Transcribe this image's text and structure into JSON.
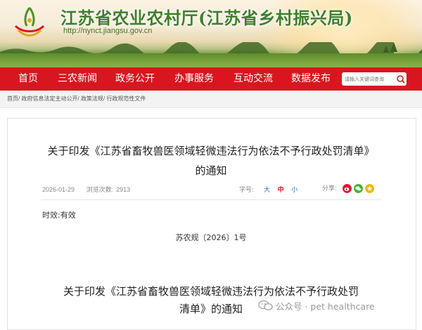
{
  "header": {
    "site_title": "江苏省农业农村厅(江苏省乡村振兴局)",
    "site_url": "http://nynct.jiangsu.gov.cn"
  },
  "nav": {
    "items": [
      "首页",
      "三农新闻",
      "政务公开",
      "办事服务",
      "互动交流",
      "数据发布"
    ],
    "search_placeholder": "请输入关键词查询"
  },
  "breadcrumb": {
    "items": [
      "首页",
      "政府信息法定主动公开",
      "政策法规",
      "行政规范性文件"
    ],
    "separator": "/"
  },
  "article": {
    "title_line1": "关于印发《江苏省畜牧兽医领域轻微违法行为依法不予行政处罚清单》",
    "title_line2": "的通知",
    "date": "2026-01-29",
    "views_label": "浏览次数:",
    "views": "2913",
    "font_size_label": "字号:",
    "font_sizes": [
      "大",
      "中",
      "小"
    ],
    "share_label": "分享:",
    "share_icons": [
      "weibo-icon",
      "wechat-icon",
      "qzone-icon"
    ],
    "validity": "时效:有效",
    "doc_number": "苏农规〔2026〕1号",
    "body_title_line1": "关于印发《江苏省畜牧兽医领域轻微违法行为依法不予行政处罚",
    "body_title_line2": "清单》的通知"
  },
  "watermark": {
    "text": "公众号 · pet healthcare"
  },
  "colors": {
    "nav_red": "#d9161f",
    "title_green": "#3e7f2c",
    "link_blue": "#2b6cc4"
  }
}
